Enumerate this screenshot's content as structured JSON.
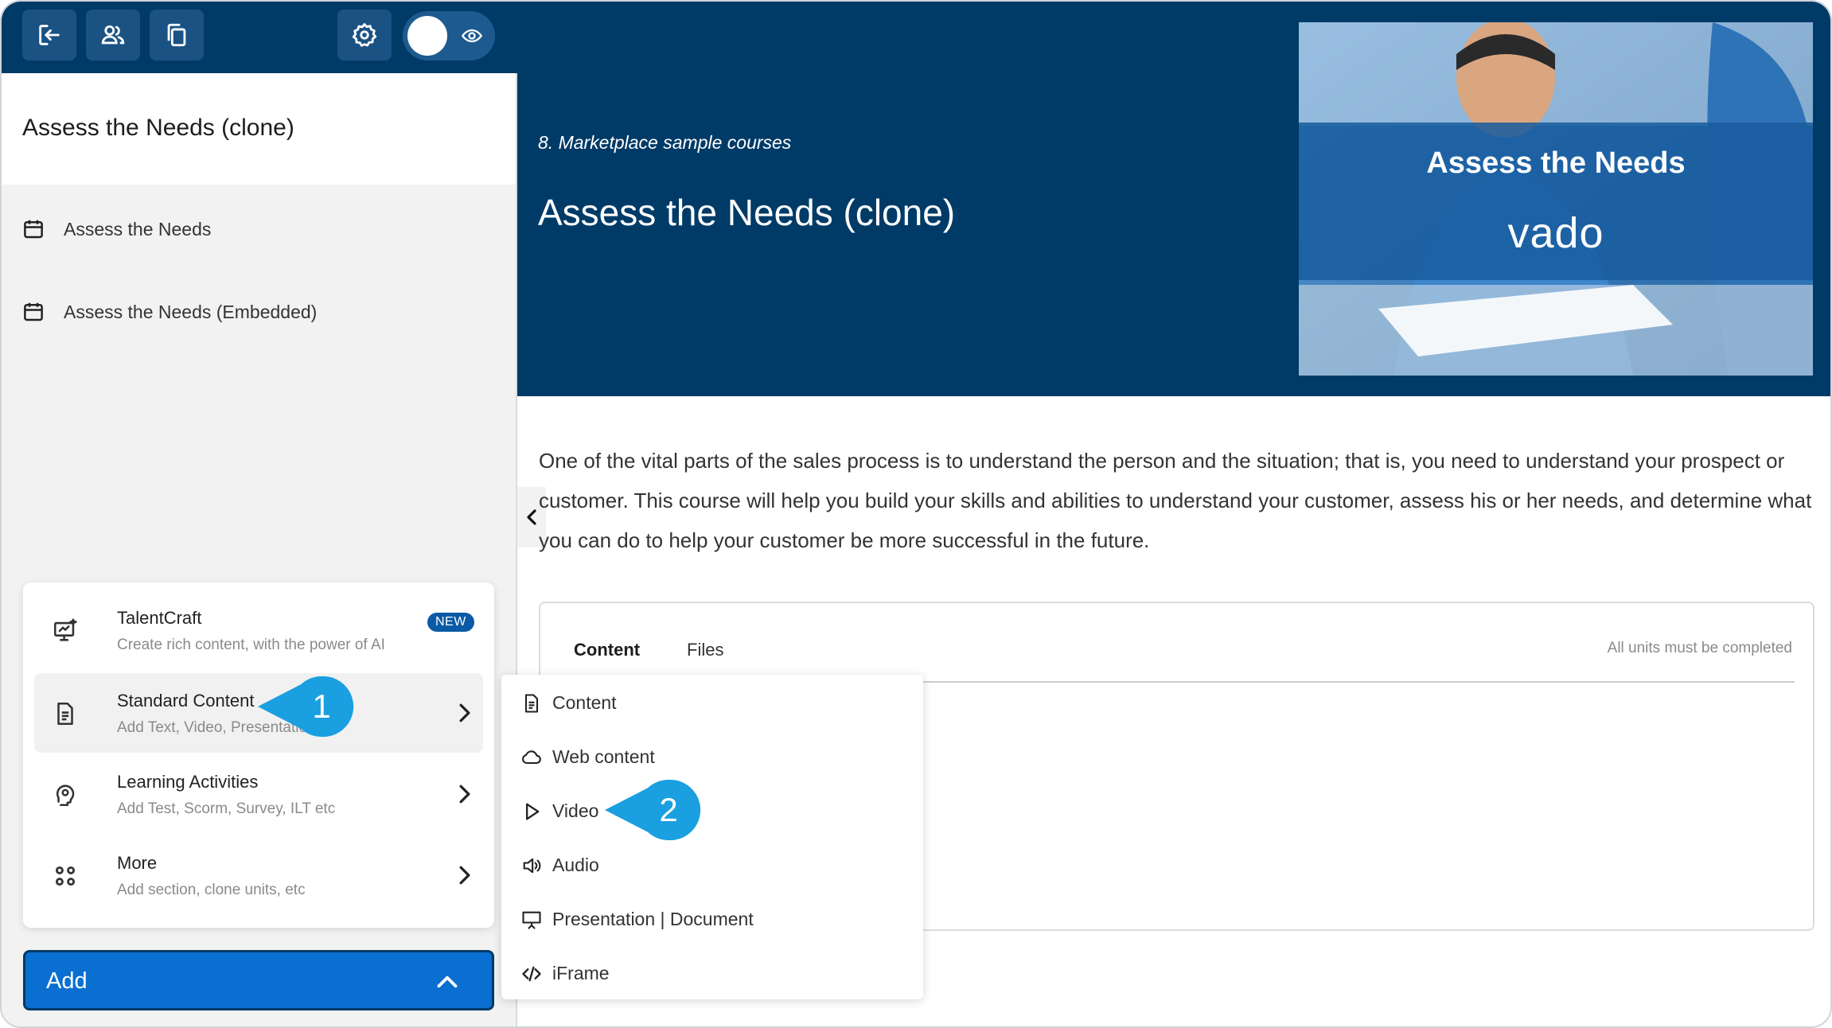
{
  "sidebar": {
    "course_title": "Assess the Needs (clone)",
    "units": [
      {
        "label": "Assess the Needs",
        "icon": "calendar-icon"
      },
      {
        "label": "Assess the Needs (Embedded)",
        "icon": "calendar-icon"
      }
    ],
    "toolbar": [
      "exit-icon",
      "users-icon",
      "copy-icon",
      "gear-icon",
      "eye-icon"
    ]
  },
  "add_menu": {
    "items": [
      {
        "title": "TalentCraft",
        "subtitle": "Create rich content, with the power of AI",
        "badge": "NEW",
        "icon": "ai-monitor-icon"
      },
      {
        "title": "Standard Content",
        "subtitle": "Add Text, Video, Presentation",
        "icon": "document-icon"
      },
      {
        "title": "Learning Activities",
        "subtitle": "Add Test, Scorm, Survey, ILT etc",
        "icon": "brain-icon"
      },
      {
        "title": "More",
        "subtitle": "Add section, clone units, etc",
        "icon": "grid-icon"
      }
    ],
    "add_button": "Add"
  },
  "submenu": {
    "items": [
      {
        "label": "Content",
        "icon": "document-icon"
      },
      {
        "label": "Web content",
        "icon": "cloud-icon"
      },
      {
        "label": "Video",
        "icon": "play-icon"
      },
      {
        "label": "Audio",
        "icon": "speaker-icon"
      },
      {
        "label": "Presentation | Document",
        "icon": "presentation-icon"
      },
      {
        "label": "iFrame",
        "icon": "code-icon"
      }
    ]
  },
  "hero": {
    "breadcrumb": "8. Marketplace sample courses",
    "title": "Assess the Needs (clone)",
    "thumbnail_title": "Assess the Needs",
    "thumbnail_brand": "vado"
  },
  "description": "One of the vital parts of the sales process is to understand the person and the situation; that is, you need to understand your prospect or customer. This course will help you build your skills and abilities to understand your customer, assess his or her needs, and determine what you can do to help your customer be more successful in the future.",
  "tabs": {
    "items": [
      "Content",
      "Files"
    ],
    "note": "All units must be completed"
  },
  "callouts": [
    "1",
    "2"
  ],
  "colors": {
    "navy": "#003b67",
    "accent_blue": "#0a6fd0",
    "callout": "#1a9fe0"
  }
}
